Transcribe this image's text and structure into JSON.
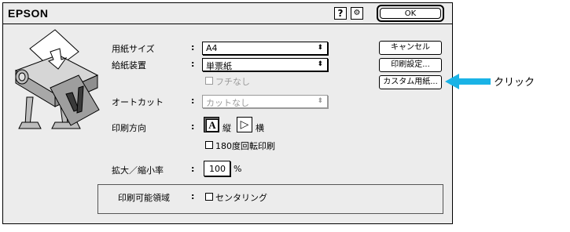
{
  "dialog": {
    "brand": "EPSON",
    "help_icon_glyph": "?",
    "settings_icon_glyph": "⚙",
    "buttons": {
      "ok": "OK",
      "cancel": "キャンセル",
      "print_settings": "印刷設定...",
      "custom_paper": "カスタム用紙..."
    },
    "fields": {
      "paper_size": {
        "label": "用紙サイズ",
        "colon": ":",
        "value": "A4"
      },
      "paper_source": {
        "label": "給紙装置",
        "colon": ":",
        "value": "単票紙"
      },
      "borderless": {
        "label": "フチなし",
        "checked": false,
        "disabled": true
      },
      "auto_cut": {
        "label": "オートカット",
        "colon": ":",
        "value": "カットなし",
        "disabled": true
      },
      "orientation": {
        "label": "印刷方向",
        "colon": ":",
        "portrait_label": "縦",
        "landscape_label": "横",
        "selected": "portrait",
        "portrait_glyph": "A",
        "landscape_glyph": "▷"
      },
      "rotate180": {
        "label": "180度回転印刷",
        "checked": false
      },
      "scale": {
        "label": "拡大／縮小率",
        "colon": ":",
        "value": "100",
        "unit": "%"
      },
      "printable_area": {
        "label": "印刷可能領域",
        "colon": ":",
        "checkbox_label": "センタリング",
        "checked": false
      }
    }
  },
  "callout": {
    "text": "クリック",
    "color": "#1ab3e6"
  },
  "colors": {
    "dialog_bg": "#ececec",
    "disabled_text": "#9a9a9a",
    "arrow": "#1ab3e6"
  }
}
